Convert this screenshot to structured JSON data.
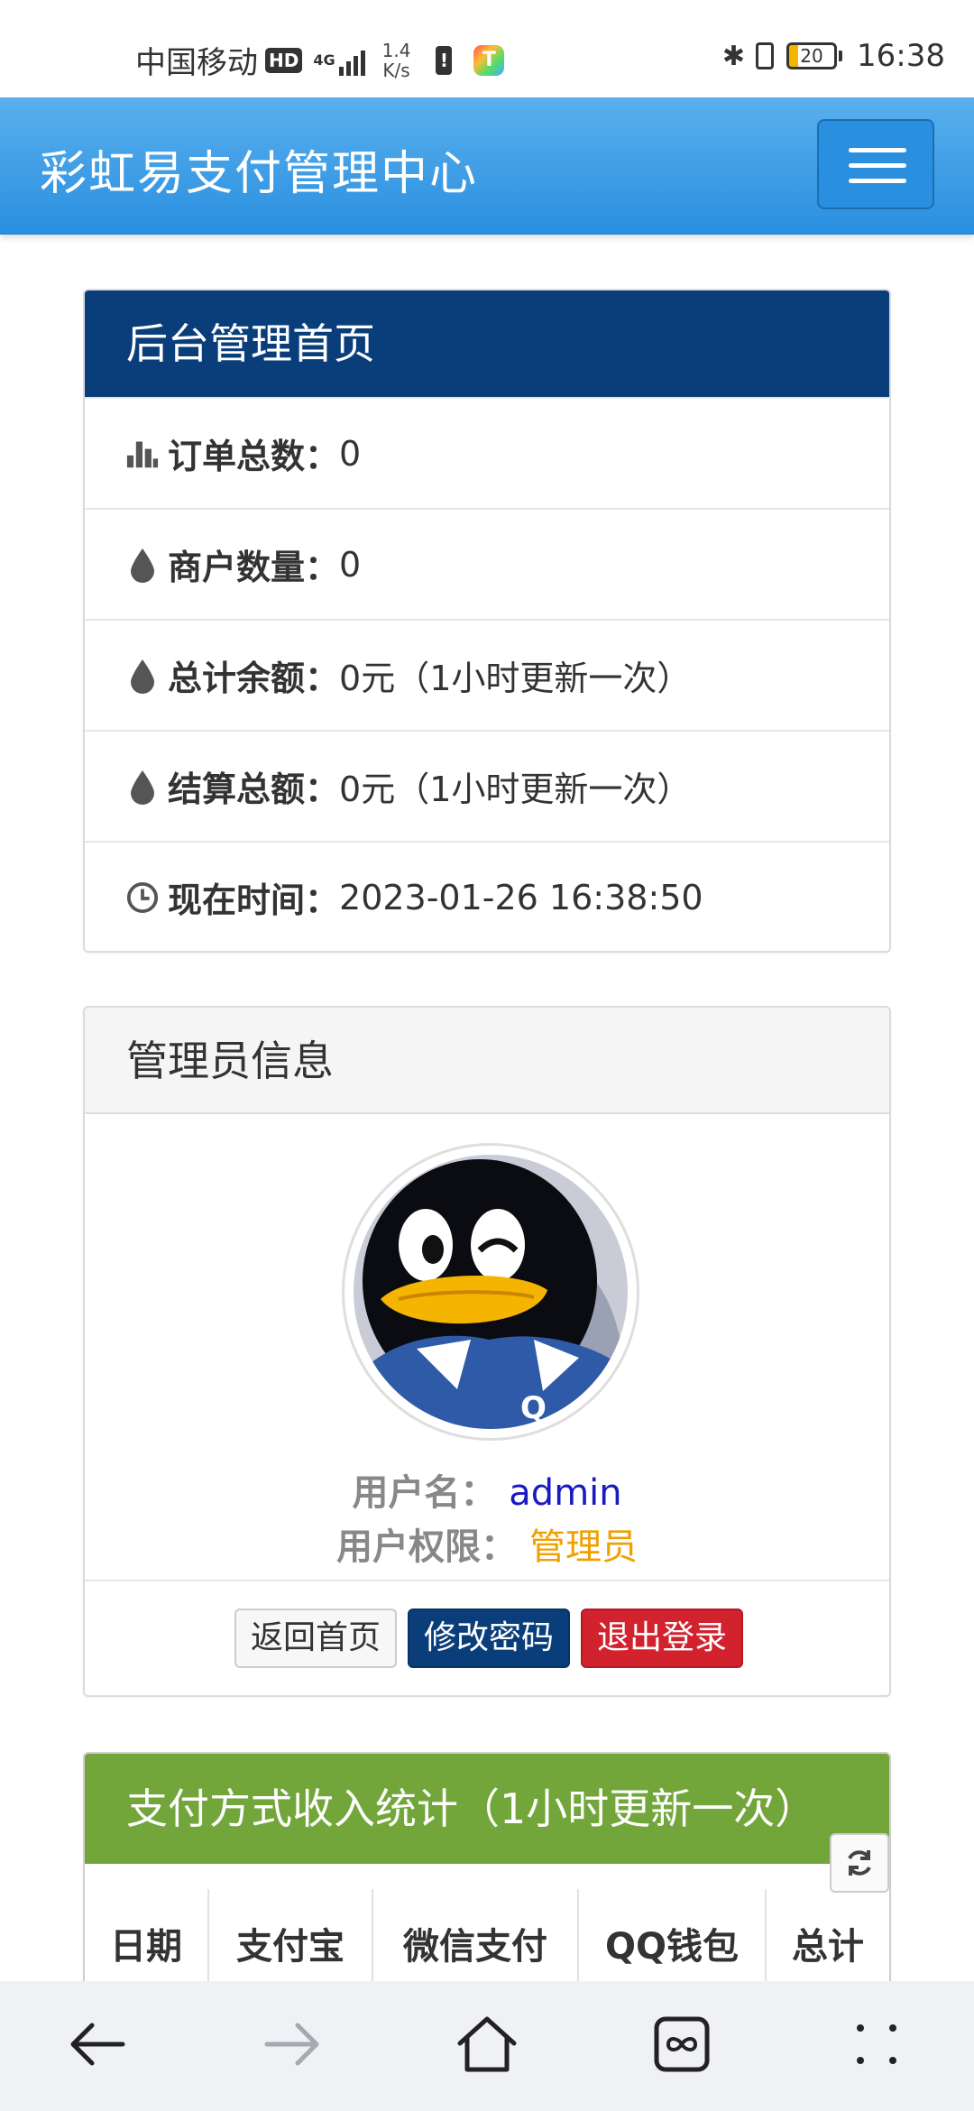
{
  "status_bar": {
    "carrier": "中国移动",
    "hd": "HD",
    "network": "4G",
    "speed_value": "1.4",
    "speed_unit": "K/s",
    "app_letter": "T",
    "battery": "20",
    "time": "16:38"
  },
  "navbar": {
    "brand": "彩虹易支付管理中心"
  },
  "dashboard": {
    "title": "后台管理首页",
    "items": [
      {
        "label": "订单总数：",
        "value": "0"
      },
      {
        "label": "商户数量：",
        "value": "0"
      },
      {
        "label": "总计余额：",
        "value": "0元（1小时更新一次）"
      },
      {
        "label": "结算总额：",
        "value": "0元（1小时更新一次）"
      },
      {
        "label": "现在时间：",
        "value": " 2023-01-26 16:38:50"
      }
    ]
  },
  "admin_panel": {
    "title": "管理员信息",
    "username_label": "用户名：",
    "username": "admin",
    "role_label": "用户权限：",
    "role": "管理员",
    "buttons": {
      "back": "返回首页",
      "change_password": "修改密码",
      "logout": "退出登录"
    }
  },
  "income_panel": {
    "title": "支付方式收入统计（1小时更新一次）",
    "columns": [
      "日期",
      "支付宝",
      "微信支付",
      "QQ钱包",
      "总计"
    ]
  },
  "colors": {
    "navbar": "#2a8fdf",
    "dashboard_header": "#0a3e7a",
    "income_header": "#72a63a",
    "logout_button": "#d2222d",
    "role_text": "#f0a000",
    "username_text": "#1a1ac2"
  }
}
